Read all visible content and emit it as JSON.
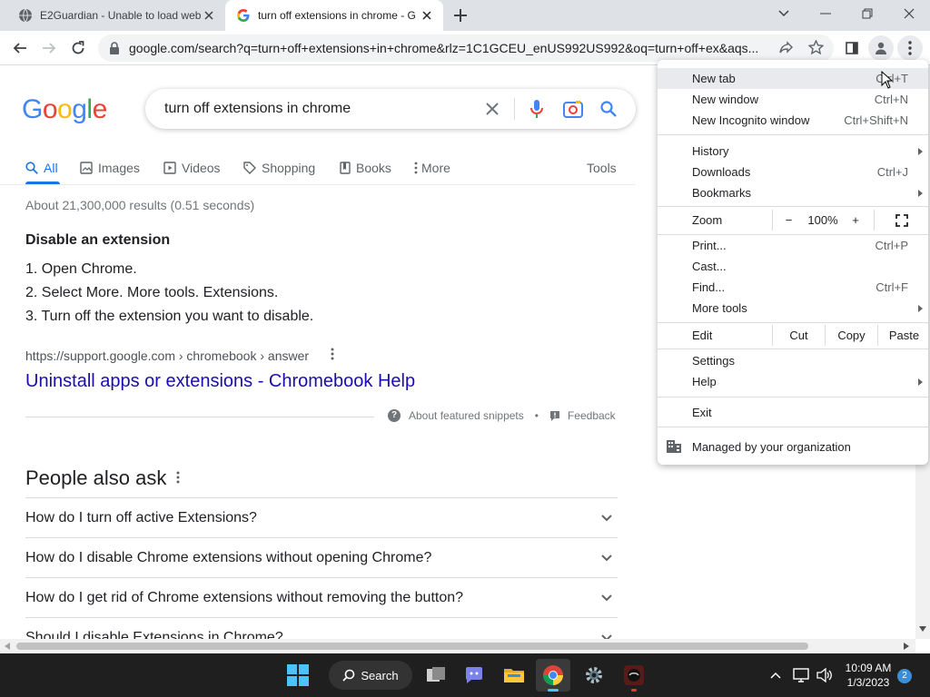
{
  "browser": {
    "tabs": [
      {
        "title": "E2Guardian - Unable to load web",
        "active": false
      },
      {
        "title": "turn off extensions in chrome - G",
        "active": true
      }
    ],
    "url": "google.com/search?q=turn+off+extensions+in+chrome&rlz=1C1GCEU_enUS992US992&oq=turn+off+ex&aqs..."
  },
  "google": {
    "logo": "Google",
    "query": "turn off extensions in chrome",
    "nav": {
      "all": "All",
      "images": "Images",
      "videos": "Videos",
      "shopping": "Shopping",
      "books": "Books",
      "more": "More",
      "tools": "Tools"
    },
    "stats": "About 21,300,000 results (0.51 seconds)",
    "snippet": {
      "title": "Disable an extension",
      "steps": [
        "1. Open Chrome.",
        "2. Select More. More tools. Extensions.",
        "3. Turn off the extension you want to disable."
      ],
      "cite": "https://support.google.com › chromebook › answer",
      "link": "Uninstall apps or extensions - Chromebook Help",
      "about": "About featured snippets",
      "sep": "•",
      "feedback": "Feedback"
    },
    "paa": {
      "title": "People also ask",
      "questions": [
        "How do I turn off active Extensions?",
        "How do I disable Chrome extensions without opening Chrome?",
        "How do I get rid of Chrome extensions without removing the button?",
        "Should I disable Extensions in Chrome?"
      ]
    }
  },
  "menu": {
    "new_tab": {
      "label": "New tab",
      "shortcut": "Ctrl+T"
    },
    "new_window": {
      "label": "New window",
      "shortcut": "Ctrl+N"
    },
    "incognito": {
      "label": "New Incognito window",
      "shortcut": "Ctrl+Shift+N"
    },
    "history": {
      "label": "History"
    },
    "downloads": {
      "label": "Downloads",
      "shortcut": "Ctrl+J"
    },
    "bookmarks": {
      "label": "Bookmarks"
    },
    "zoom": {
      "label": "Zoom",
      "minus": "−",
      "level": "100%",
      "plus": "+"
    },
    "print": {
      "label": "Print...",
      "shortcut": "Ctrl+P"
    },
    "cast": {
      "label": "Cast..."
    },
    "find": {
      "label": "Find...",
      "shortcut": "Ctrl+F"
    },
    "more_tools": {
      "label": "More tools"
    },
    "edit": {
      "label": "Edit",
      "cut": "Cut",
      "copy": "Copy",
      "paste": "Paste"
    },
    "settings": {
      "label": "Settings"
    },
    "help": {
      "label": "Help"
    },
    "exit": {
      "label": "Exit"
    },
    "managed": {
      "label": "Managed by your organization"
    }
  },
  "taskbar": {
    "search_label": "Search",
    "time": "10:09 AM",
    "date": "1/3/2023",
    "notifications": "2"
  },
  "colors": {
    "accent": "#1a73e8",
    "link": "#1a0dab"
  }
}
